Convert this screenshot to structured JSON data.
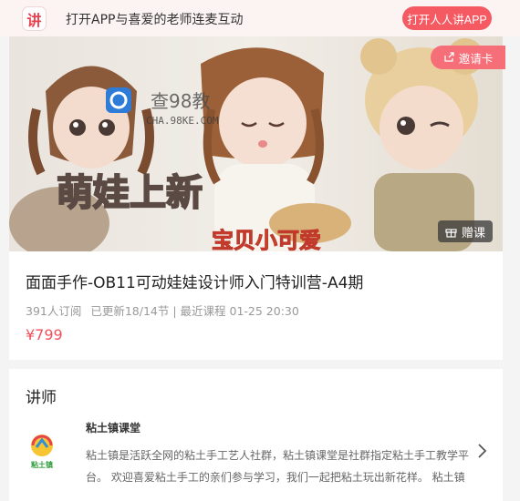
{
  "app_bar": {
    "logo_char": "讲",
    "promo_text": "打开APP与喜爱的老师连麦互动",
    "open_button": "打开人人讲APP"
  },
  "course": {
    "invite_label": "邀请卡",
    "gift_label": "赠课",
    "cover_title": "萌娃上新",
    "cover_subtitle": "宝贝小可爱",
    "watermark_text": "查98教",
    "watermark_url": "CHA.98KE.COM",
    "title": "面面手作-OB11可动娃娃设计师入门特训营-A4期",
    "subscribers": "391人订阅",
    "updated": "已更新18/14节 | 最近课程 01-25 20:30",
    "price": "¥799"
  },
  "teacher": {
    "heading": "讲师",
    "name": "粘土镇课堂",
    "avatar_caption": "粘土镇",
    "description": "粘土镇是活跃全网的粘土手工艺人社群，粘土镇课堂是社群指定粘土手工教学平台。 欢迎喜爱粘土手工的亲们参与学习，我们一起把粘土玩出新花样。 粘土镇"
  },
  "colors": {
    "accent": "#f55a63",
    "price": "#f0505b",
    "banner_bg": "#fcf3f3"
  }
}
